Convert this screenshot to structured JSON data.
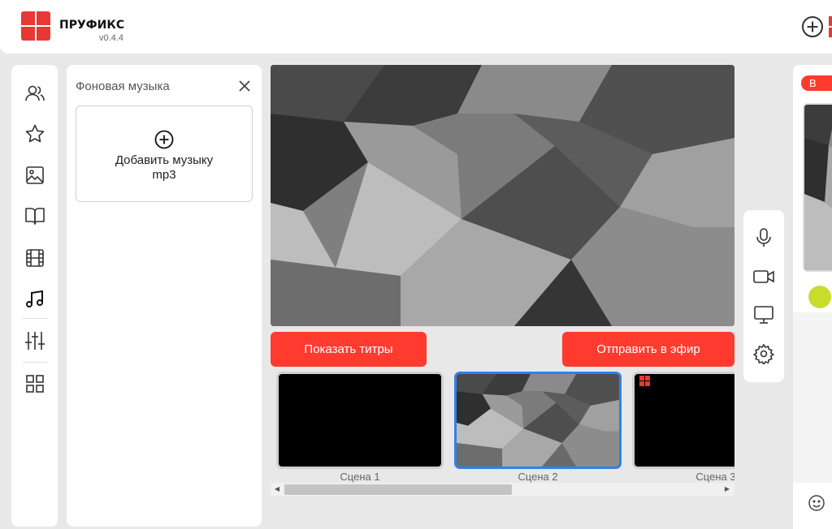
{
  "app": {
    "name": "ПРУФИКС",
    "version": "v0.4.4",
    "brand_color": "#e53935"
  },
  "header": {
    "add_icon": "plus-circle-icon"
  },
  "sidebar": {
    "items": [
      {
        "icon": "users-icon"
      },
      {
        "icon": "star-icon"
      },
      {
        "icon": "image-icon"
      },
      {
        "icon": "book-icon"
      },
      {
        "icon": "film-icon"
      },
      {
        "icon": "music-note-icon",
        "active": true
      },
      {
        "icon": "sliders-icon"
      },
      {
        "icon": "grid-icon"
      }
    ]
  },
  "music_panel": {
    "title": "Фоновая музыка",
    "close_icon": "close-icon",
    "add_line1": "Добавить музыку",
    "add_line2": "mp3"
  },
  "controls": {
    "show_titles": "Показать титры",
    "send_to_air": "Отправить в эфир",
    "accent_color": "#ff3b30"
  },
  "scenes": [
    {
      "label": "Сцена 1",
      "type": "black",
      "active": false
    },
    {
      "label": "Сцена 2",
      "type": "image",
      "active": true
    },
    {
      "label": "Сцена 3",
      "type": "black-logo",
      "active": false
    }
  ],
  "side_tools": [
    {
      "icon": "microphone-icon"
    },
    {
      "icon": "camera-icon"
    },
    {
      "icon": "monitor-icon"
    },
    {
      "icon": "gear-icon"
    }
  ],
  "right_panel": {
    "live_badge": "В эфире",
    "emoji_icon": "smiley-icon"
  }
}
